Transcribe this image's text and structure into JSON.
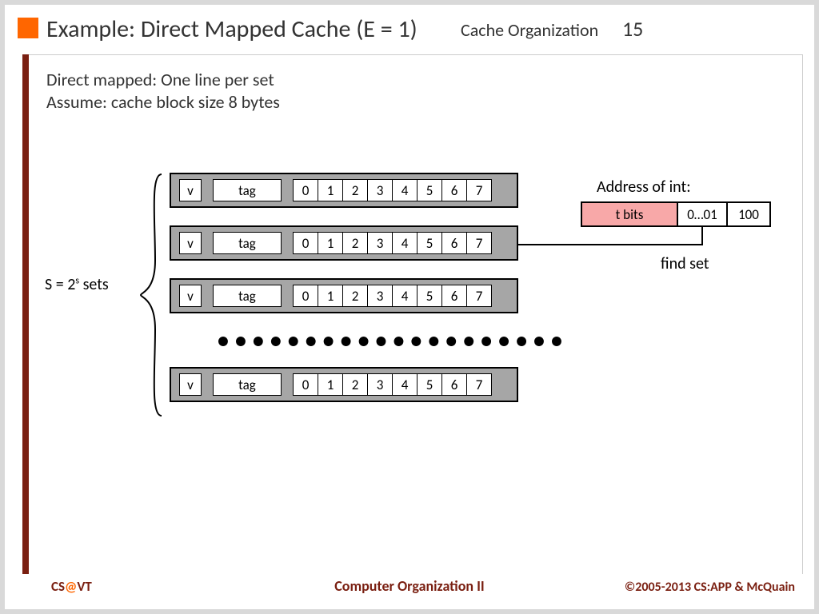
{
  "header": {
    "title": "Example: Direct Mapped Cache (E = 1)",
    "topic": "Cache Organization",
    "slide_num": "15"
  },
  "subtitle": {
    "line1": "Direct mapped: One line per set",
    "line2": "Assume: cache block size 8 bytes"
  },
  "sets_label_pre": "S = 2",
  "sets_label_sup": "s",
  "sets_label_post": " sets",
  "row": {
    "v": "v",
    "tag": "tag",
    "bytes": [
      "0",
      "1",
      "2",
      "3",
      "4",
      "5",
      "6",
      "7"
    ]
  },
  "address": {
    "label": "Address of int:",
    "t": "t bits",
    "s": "0…01",
    "b": "100",
    "findset": "find set"
  },
  "footer": {
    "cs": "CS",
    "at": "@",
    "vt": "VT",
    "course": "Computer Organization II",
    "copy": "©2005-2013 CS:APP & McQuain"
  }
}
